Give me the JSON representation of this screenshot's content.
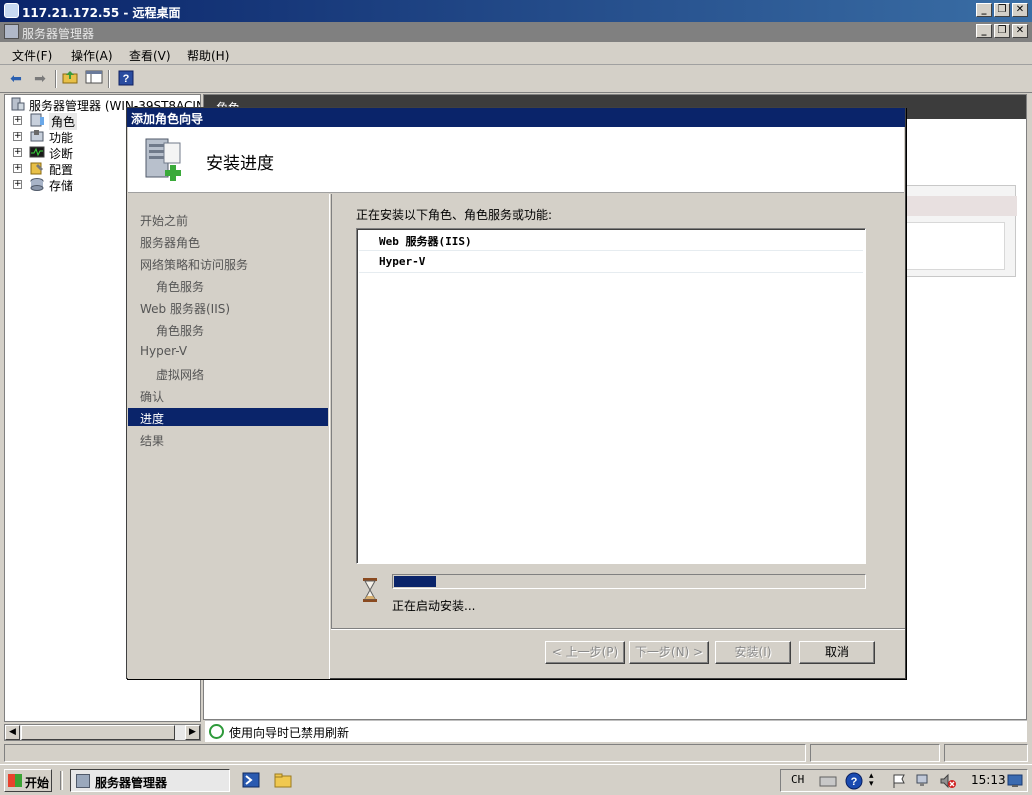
{
  "rdp": {
    "title": "117.21.172.55 - 远程桌面"
  },
  "server_manager": {
    "title": "服务器管理器"
  },
  "menu": {
    "items": [
      "文件(F)",
      "操作(A)",
      "查看(V)",
      "帮助(H)"
    ]
  },
  "window_buttons": {
    "minimize": "_",
    "restore": "❐",
    "close": "✕"
  },
  "tree": {
    "root": "服务器管理器 (WIN-39ST8ACINT",
    "items": [
      "角色",
      "功能",
      "诊断",
      "配置",
      "存储"
    ]
  },
  "right_pane": {
    "header": "角色"
  },
  "wizard": {
    "title": "添加角色向导",
    "heading": "安装进度",
    "nav": [
      "开始之前",
      "服务器角色",
      "网络策略和访问服务",
      "角色服务",
      "Web 服务器(IIS)",
      "角色服务",
      "Hyper-V",
      "虚拟网络",
      "确认",
      "进度",
      "结果"
    ],
    "active_nav": "进度",
    "prompt": "正在安装以下角色、角色服务或功能:",
    "installing": [
      "Web 服务器(IIS)",
      "Hyper-V"
    ],
    "progress": 0.09,
    "progress_text": "正在启动安装...",
    "buttons": {
      "prev": "< 上一步(P)",
      "next": "下一步(N) >",
      "install": "安装(I)",
      "cancel": "取消"
    }
  },
  "status": {
    "refresh_text": "使用向导时已禁用刷新"
  },
  "taskbar": {
    "start": "开始",
    "task": "服务器管理器",
    "ime": "CH",
    "clock": "15:13"
  }
}
